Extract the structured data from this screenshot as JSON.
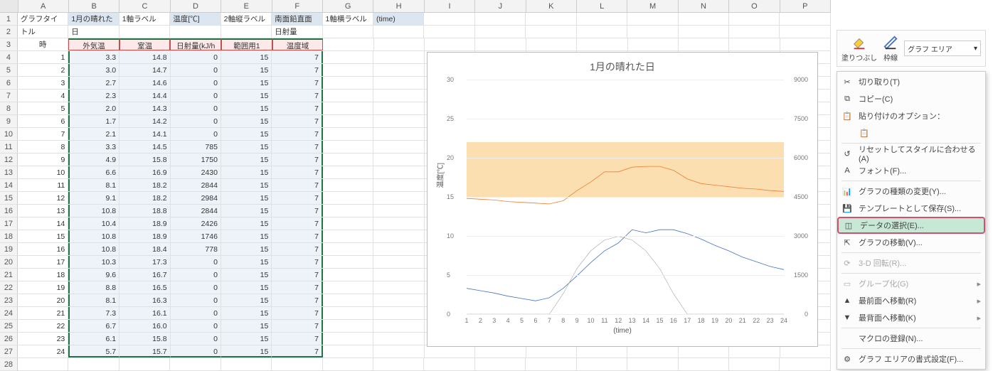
{
  "cols": [
    "A",
    "B",
    "C",
    "D",
    "E",
    "F",
    "G",
    "H",
    "I",
    "J",
    "K",
    "L",
    "M",
    "N",
    "O",
    "P"
  ],
  "row1": {
    "a": "グラフタイトル",
    "b": "1月の晴れた日",
    "c": "1軸ラベル",
    "d": "温度[℃]",
    "e": "2軸縦ラベル",
    "f": "南面鉛直面日射量[kJ/h・㎡]",
    "g": "1軸横ラベル",
    "h": "(time)"
  },
  "row3": {
    "a": "時",
    "b": "外気温",
    "c": "室温",
    "d": "日射量(kJ/h㎡)",
    "e": "範囲用1",
    "f": "温度域"
  },
  "data_rows": [
    {
      "t": 1,
      "o": 3.3,
      "r": 14.8,
      "s": 0,
      "h": 15,
      "w": 7
    },
    {
      "t": 2,
      "o": 3.0,
      "r": 14.7,
      "s": 0,
      "h": 15,
      "w": 7
    },
    {
      "t": 3,
      "o": 2.7,
      "r": 14.6,
      "s": 0,
      "h": 15,
      "w": 7
    },
    {
      "t": 4,
      "o": 2.3,
      "r": 14.4,
      "s": 0,
      "h": 15,
      "w": 7
    },
    {
      "t": 5,
      "o": 2.0,
      "r": 14.3,
      "s": 0,
      "h": 15,
      "w": 7
    },
    {
      "t": 6,
      "o": 1.7,
      "r": 14.2,
      "s": 0,
      "h": 15,
      "w": 7
    },
    {
      "t": 7,
      "o": 2.1,
      "r": 14.1,
      "s": 0,
      "h": 15,
      "w": 7
    },
    {
      "t": 8,
      "o": 3.3,
      "r": 14.5,
      "s": 785,
      "h": 15,
      "w": 7
    },
    {
      "t": 9,
      "o": 4.9,
      "r": 15.8,
      "s": 1750,
      "h": 15,
      "w": 7
    },
    {
      "t": 10,
      "o": 6.6,
      "r": 16.9,
      "s": 2430,
      "h": 15,
      "w": 7
    },
    {
      "t": 11,
      "o": 8.1,
      "r": 18.2,
      "s": 2844,
      "h": 15,
      "w": 7
    },
    {
      "t": 12,
      "o": 9.1,
      "r": 18.2,
      "s": 2984,
      "h": 15,
      "w": 7
    },
    {
      "t": 13,
      "o": 10.8,
      "r": 18.8,
      "s": 2844,
      "h": 15,
      "w": 7
    },
    {
      "t": 14,
      "o": 10.4,
      "r": 18.9,
      "s": 2426,
      "h": 15,
      "w": 7
    },
    {
      "t": 15,
      "o": 10.8,
      "r": 18.9,
      "s": 1746,
      "h": 15,
      "w": 7
    },
    {
      "t": 16,
      "o": 10.8,
      "r": 18.4,
      "s": 778,
      "h": 15,
      "w": 7
    },
    {
      "t": 17,
      "o": 10.3,
      "r": 17.3,
      "s": 0,
      "h": 15,
      "w": 7
    },
    {
      "t": 18,
      "o": 9.6,
      "r": 16.7,
      "s": 0,
      "h": 15,
      "w": 7
    },
    {
      "t": 19,
      "o": 8.8,
      "r": 16.5,
      "s": 0,
      "h": 15,
      "w": 7
    },
    {
      "t": 20,
      "o": 8.1,
      "r": 16.3,
      "s": 0,
      "h": 15,
      "w": 7
    },
    {
      "t": 21,
      "o": 7.3,
      "r": 16.1,
      "s": 0,
      "h": 15,
      "w": 7
    },
    {
      "t": 22,
      "o": 6.7,
      "r": 16.0,
      "s": 0,
      "h": 15,
      "w": 7
    },
    {
      "t": 23,
      "o": 6.1,
      "r": 15.8,
      "s": 0,
      "h": 15,
      "w": 7
    },
    {
      "t": 24,
      "o": 5.7,
      "r": 15.7,
      "s": 0,
      "h": 15,
      "w": 7
    }
  ],
  "chart_data": {
    "type": "line",
    "title": "1月の晴れた日",
    "xlabel": "(time)",
    "ylabel": "温度[℃]",
    "x": [
      1,
      2,
      3,
      4,
      5,
      6,
      7,
      8,
      9,
      10,
      11,
      12,
      13,
      14,
      15,
      16,
      17,
      18,
      19,
      20,
      21,
      22,
      23,
      24
    ],
    "y1lim": [
      0,
      30
    ],
    "y1ticks": [
      0,
      5,
      10,
      15,
      20,
      25,
      30
    ],
    "y2lim": [
      0,
      9000
    ],
    "y2ticks": [
      0,
      1500,
      3000,
      4500,
      6000,
      7500,
      9000
    ],
    "band": {
      "from": 15,
      "to": 22
    },
    "series": [
      {
        "name": "室温",
        "axis": "y1",
        "color": "#ed7d31",
        "values": [
          14.8,
          14.7,
          14.6,
          14.4,
          14.3,
          14.2,
          14.1,
          14.5,
          15.8,
          16.9,
          18.2,
          18.2,
          18.8,
          18.9,
          18.9,
          18.4,
          17.3,
          16.7,
          16.5,
          16.3,
          16.1,
          16.0,
          15.8,
          15.7
        ]
      },
      {
        "name": "外気温",
        "axis": "y1",
        "color": "#4472c4",
        "values": [
          3.3,
          3.0,
          2.7,
          2.3,
          2.0,
          1.7,
          2.1,
          3.3,
          4.9,
          6.6,
          8.1,
          9.1,
          10.8,
          10.4,
          10.8,
          10.8,
          10.3,
          9.6,
          8.8,
          8.1,
          7.3,
          6.7,
          6.1,
          5.7
        ]
      },
      {
        "name": "日射量",
        "axis": "y2",
        "color": "#a5a5a5",
        "values": [
          0,
          0,
          0,
          0,
          0,
          0,
          0,
          785,
          1750,
          2430,
          2844,
          2984,
          2844,
          2426,
          1746,
          778,
          0,
          0,
          0,
          0,
          0,
          0,
          0,
          0
        ]
      }
    ]
  },
  "tools": {
    "fill": "塗りつぶし",
    "outline": "枠線",
    "dropdown": "グラフ エリア"
  },
  "menu": {
    "cut": "切り取り(T)",
    "copy": "コピー(C)",
    "paste_opt": "貼り付けのオプション：",
    "reset": "リセットしてスタイルに合わせる(A)",
    "font": "フォント(F)...",
    "change_type": "グラフの種類の変更(Y)...",
    "save_tpl": "テンプレートとして保存(S)...",
    "select_data": "データの選択(E)...",
    "move_chart": "グラフの移動(V)...",
    "rotate3d": "3-D 回転(R)...",
    "group": "グループ化(G)",
    "front": "最前面へ移動(R)",
    "back": "最背面へ移動(K)",
    "macro": "マクロの登録(N)...",
    "format": "グラフ エリアの書式設定(F)..."
  }
}
